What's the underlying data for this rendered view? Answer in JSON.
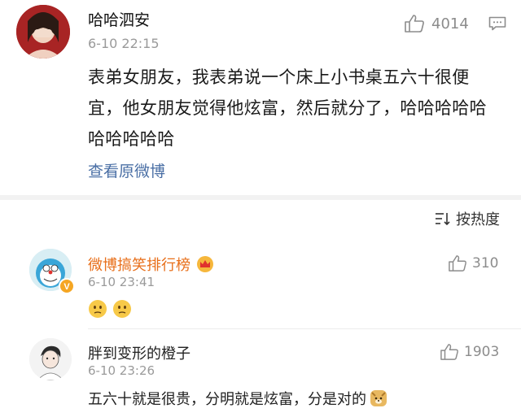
{
  "post": {
    "author": "哈哈泗安",
    "time": "6-10 22:15",
    "likes": "4014",
    "text": "表弟女朋友，我表弟说一个床上小书桌五六十很便宜，他女朋友觉得他炫富，然后就分了，哈哈哈哈哈哈哈哈哈哈",
    "view_original": "查看原微博",
    "icons": {
      "like": "thumbs-up-icon",
      "comment": "comment-bubble-icon"
    }
  },
  "sort": {
    "label": "按热度",
    "icon": "sort-icon"
  },
  "comments": [
    {
      "author": "微博搞笑排行榜",
      "time": "6-10 23:41",
      "likes": "310",
      "badge": "crown-badge-icon",
      "verified": "verified-badge-icon",
      "text_emojis": [
        "thinking-face-emoji",
        "thinking-face-emoji"
      ]
    },
    {
      "author": "胖到变形的橙子",
      "time": "6-10 23:26",
      "likes": "1903",
      "text": "五六十就是很贵，分明就是炫富，分是对的",
      "trailing_emoji": "doge-emoji"
    }
  ],
  "colors": {
    "link": "#4a6fa5",
    "vip_name": "#e86f1a",
    "muted": "#9a9a9a",
    "divider": "#f2f2f2"
  }
}
